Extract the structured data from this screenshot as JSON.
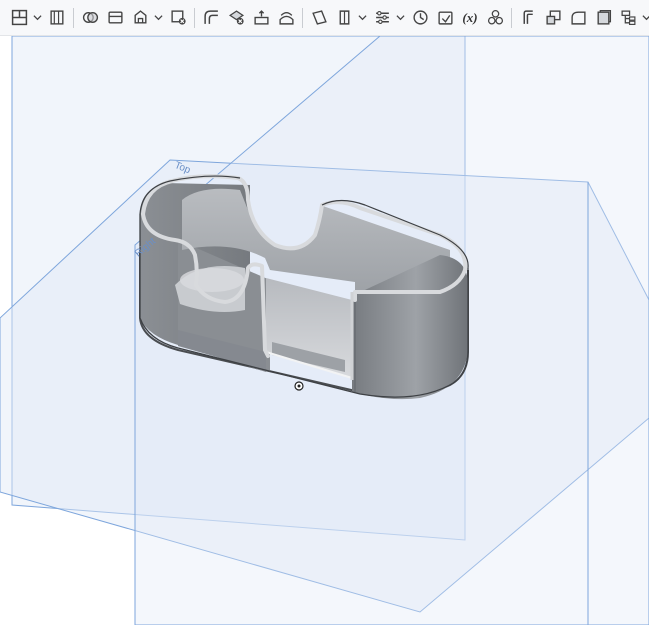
{
  "app": {
    "toolbar": {
      "buttons": [
        {
          "name": "part-studio-menu-icon"
        },
        {
          "name": "sketch-icon"
        },
        {
          "name": "boolean-icon"
        },
        {
          "name": "split-icon"
        },
        {
          "name": "transform-icon"
        },
        {
          "name": "delete-part-icon"
        },
        {
          "name": "modify-fillet-icon"
        },
        {
          "name": "delete-face-icon"
        },
        {
          "name": "move-face-icon"
        },
        {
          "name": "replace-face-icon"
        },
        {
          "name": "plane-icon"
        },
        {
          "name": "mate-connector-icon"
        },
        {
          "name": "pattern-icon"
        },
        {
          "name": "rollback-icon"
        },
        {
          "name": "measure-icon"
        },
        {
          "name": "variable-icon",
          "label": "(x)"
        },
        {
          "name": "mass-properties-icon"
        },
        {
          "name": "sheet-metal-icon"
        },
        {
          "name": "frame-icon"
        },
        {
          "name": "surface-icon"
        },
        {
          "name": "shell-icon"
        },
        {
          "name": "hierarchy-icon"
        }
      ]
    }
  },
  "viewport": {
    "planes": {
      "top_label": "Top",
      "right_label": "Right"
    },
    "colors": {
      "plane_fill": "#dfe9f6",
      "plane_edge": "#7ea6dc",
      "part_gray": "#8d9196"
    }
  }
}
